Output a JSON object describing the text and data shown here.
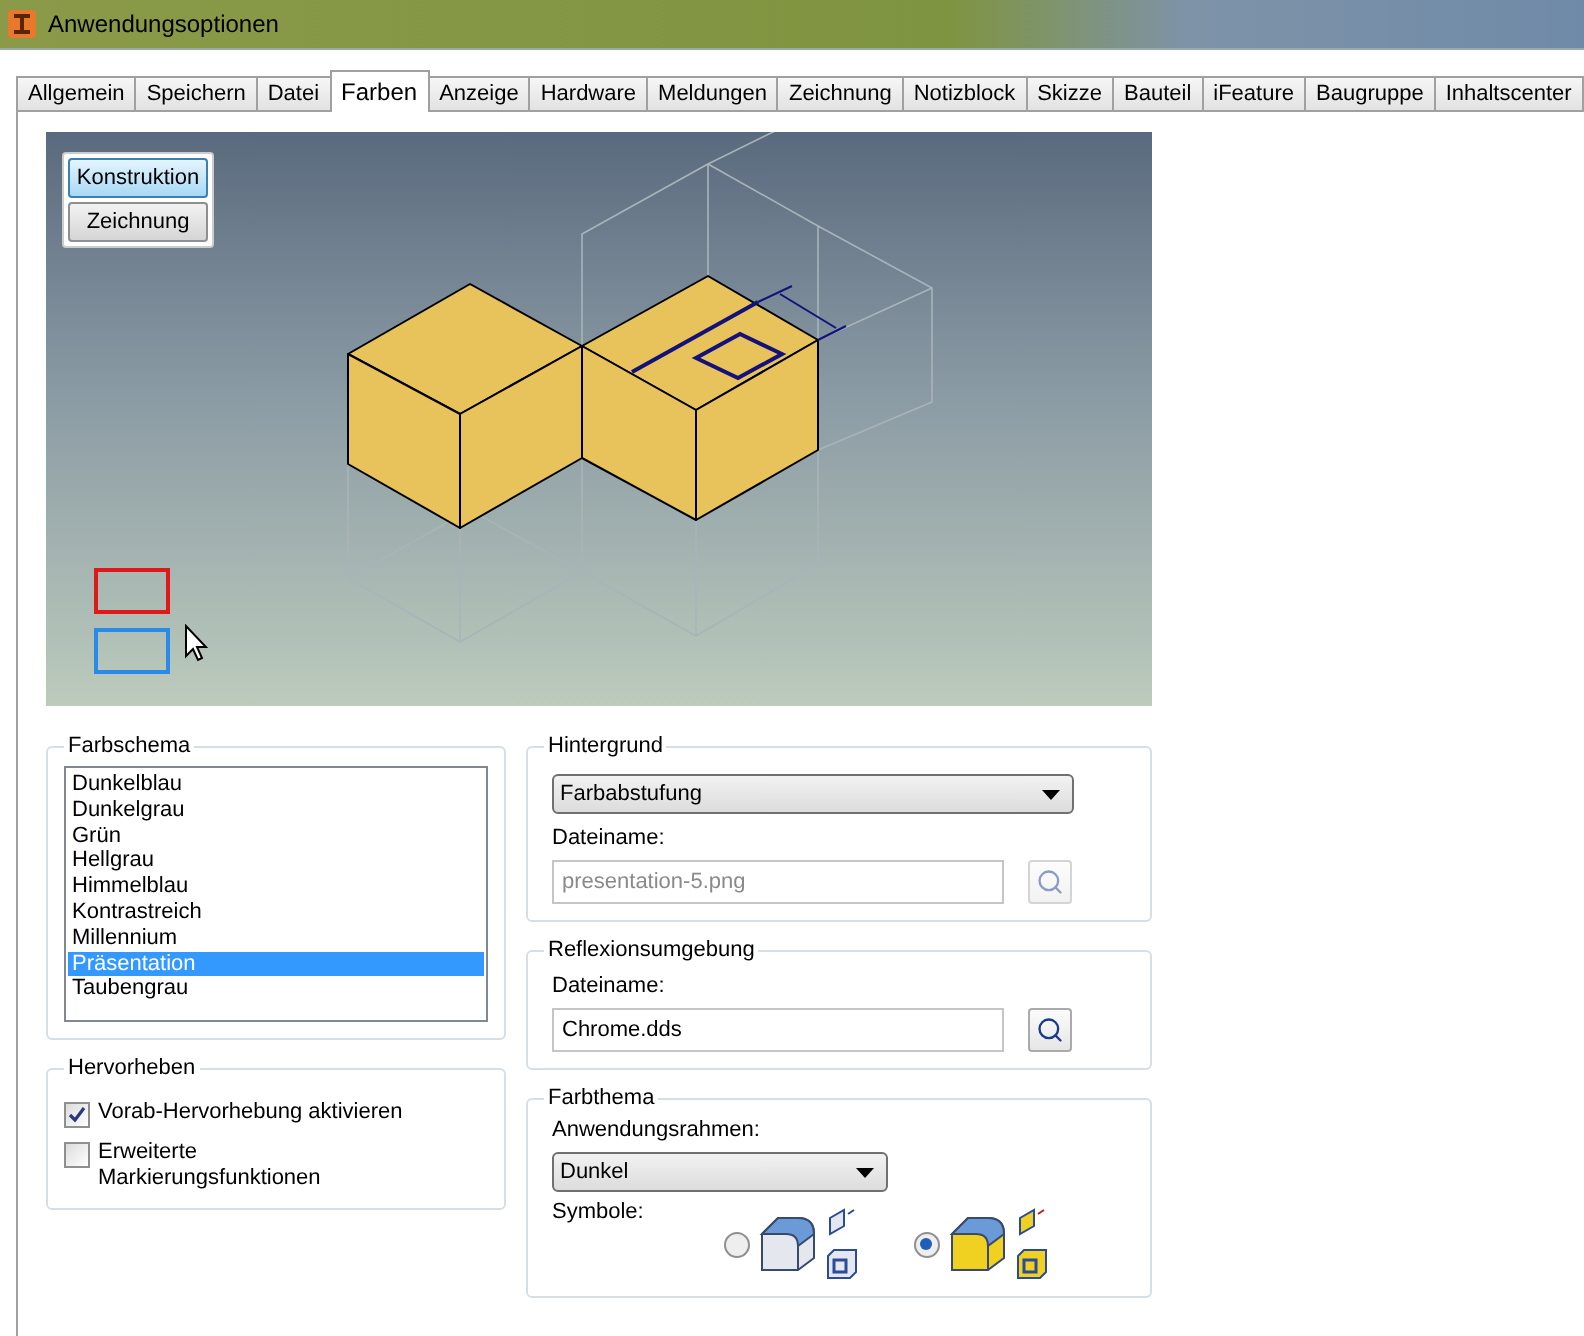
{
  "window": {
    "title": "Anwendungsoptionen"
  },
  "tabs": [
    {
      "label": "Allgemein",
      "selected": false
    },
    {
      "label": "Speichern",
      "selected": false
    },
    {
      "label": "Datei",
      "selected": false
    },
    {
      "label": "Farben",
      "selected": true
    },
    {
      "label": "Anzeige",
      "selected": false
    },
    {
      "label": "Hardware",
      "selected": false
    },
    {
      "label": "Meldungen",
      "selected": false
    },
    {
      "label": "Zeichnung",
      "selected": false
    },
    {
      "label": "Notizblock",
      "selected": false
    },
    {
      "label": "Skizze",
      "selected": false
    },
    {
      "label": "Bauteil",
      "selected": false
    },
    {
      "label": "iFeature",
      "selected": false
    },
    {
      "label": "Baugruppe",
      "selected": false
    },
    {
      "label": "Inhaltscenter",
      "selected": false
    }
  ],
  "preview": {
    "modes": [
      {
        "label": "Konstruktion",
        "selected": true
      },
      {
        "label": "Zeichnung",
        "selected": false
      }
    ]
  },
  "color_scheme": {
    "title": "Farbschema",
    "items": [
      {
        "label": "Dunkelblau",
        "selected": false
      },
      {
        "label": "Dunkelgrau",
        "selected": false
      },
      {
        "label": "Grün",
        "selected": false
      },
      {
        "label": "Hellgrau",
        "selected": false
      },
      {
        "label": "Himmelblau",
        "selected": false
      },
      {
        "label": "Kontrastreich",
        "selected": false
      },
      {
        "label": "Millennium",
        "selected": false
      },
      {
        "label": "Präsentation",
        "selected": true
      },
      {
        "label": "Taubengrau",
        "selected": false
      }
    ]
  },
  "highlight": {
    "title": "Hervorheben",
    "options": [
      {
        "label": "Vorab-Hervorhebung aktivieren",
        "checked": true
      },
      {
        "label": "Erweiterte Markierungsfunktionen",
        "checked": false
      }
    ]
  },
  "background": {
    "title": "Hintergrund",
    "dropdown": {
      "value": "Farbabstufung"
    },
    "file_label": "Dateiname:",
    "file": {
      "value": "presentation-5.png",
      "disabled": true
    }
  },
  "reflection": {
    "title": "Reflexionsumgebung",
    "file_label": "Dateiname:",
    "file": {
      "value": "Chrome.dds",
      "disabled": false
    }
  },
  "color_theme": {
    "title": "Farbthema",
    "frame_label": "Anwendungsrahmen:",
    "frame_dropdown": {
      "value": "Dunkel"
    },
    "symbols_label": "Symbole:",
    "symbol_options": [
      {
        "kind": "grey",
        "selected": false
      },
      {
        "kind": "yellow",
        "selected": true
      }
    ]
  }
}
